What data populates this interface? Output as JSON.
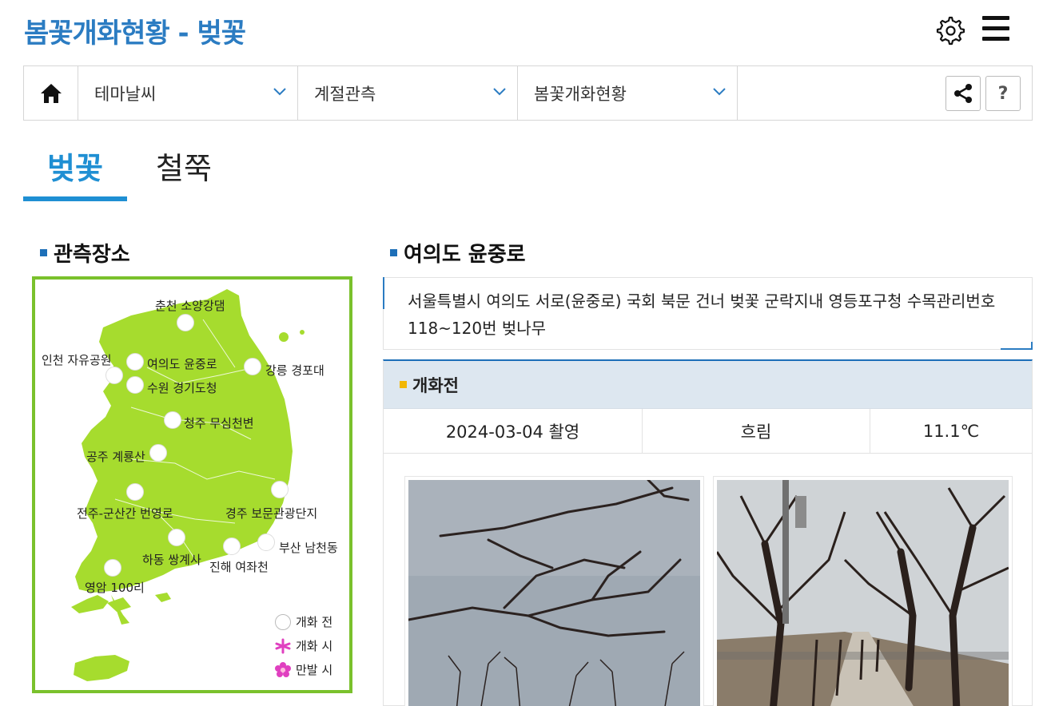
{
  "header": {
    "title": "봄꽃개화현황 - 벚꽃",
    "settings_icon": "gear-icon",
    "menu_icon": "hamburger-icon"
  },
  "breadcrumb": {
    "home_icon": "home-icon",
    "items": [
      {
        "label": "테마날씨"
      },
      {
        "label": "계절관측"
      },
      {
        "label": "봄꽃개화현황"
      }
    ],
    "share_icon": "share-icon",
    "help_label": "?"
  },
  "tabs": [
    {
      "label": "벚꽃",
      "active": true
    },
    {
      "label": "철쭉",
      "active": false
    }
  ],
  "observation": {
    "title": "관측장소",
    "sites": [
      {
        "name": "춘천 소양강댐"
      },
      {
        "name": "인천 자유공원"
      },
      {
        "name": "여의도 윤중로"
      },
      {
        "name": "강릉 경포대"
      },
      {
        "name": "수원 경기도청"
      },
      {
        "name": "청주 무심천변"
      },
      {
        "name": "공주 계룡산"
      },
      {
        "name": "전주-군산간 번영로"
      },
      {
        "name": "경주 보문관광단지"
      },
      {
        "name": "부산 남천동"
      },
      {
        "name": "하동 쌍계사"
      },
      {
        "name": "진해 여좌천"
      },
      {
        "name": "영암 100리"
      }
    ],
    "legend": [
      {
        "label": "개화 전",
        "icon": "circle-icon"
      },
      {
        "label": "개화 시",
        "icon": "flower-outline-icon",
        "color": "#e040c0"
      },
      {
        "label": "만발 시",
        "icon": "flower-filled-icon",
        "color": "#e040c0"
      }
    ]
  },
  "detail": {
    "title": "여의도 윤중로",
    "address": "서울특별시 여의도 서로(윤중로) 국회 북문 건너 벚꽃 군락지내 영등포구청 수목관리번호 118~120번 벚나무",
    "status": "개화전",
    "date": "2024-03-04 촬영",
    "weather": "흐림",
    "temperature": "11.1℃"
  },
  "colors": {
    "accent": "#2b7cc2",
    "tab_active": "#1f8fd3",
    "map_land": "#a6dc2e",
    "map_border": "#7ac12c",
    "status_bullet": "#f2b705"
  }
}
